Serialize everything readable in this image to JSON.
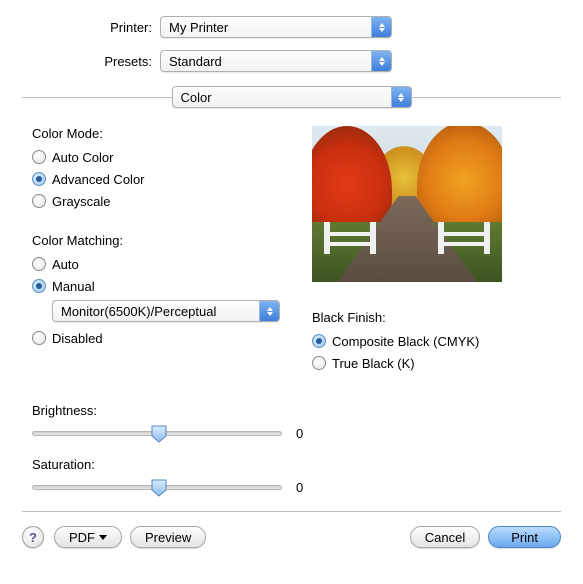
{
  "top": {
    "printer_label": "Printer:",
    "printer_value": "My Printer",
    "presets_label": "Presets:",
    "presets_value": "Standard",
    "panel_value": "Color"
  },
  "color_mode": {
    "label": "Color Mode:",
    "options": [
      "Auto Color",
      "Advanced Color",
      "Grayscale"
    ]
  },
  "color_matching": {
    "label": "Color Matching:",
    "auto": "Auto",
    "manual": "Manual",
    "manual_profile": "Monitor(6500K)/Perceptual",
    "disabled": "Disabled"
  },
  "black_finish": {
    "label": "Black Finish:",
    "options": [
      "Composite Black (CMYK)",
      "True Black (K)"
    ]
  },
  "sliders": {
    "brightness_label": "Brightness:",
    "brightness_value": "0",
    "saturation_label": "Saturation:",
    "saturation_value": "0"
  },
  "footer": {
    "help": "?",
    "pdf": "PDF",
    "preview": "Preview",
    "cancel": "Cancel",
    "print": "Print"
  }
}
